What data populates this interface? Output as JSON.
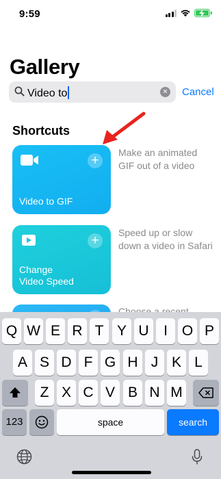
{
  "status_bar": {
    "time": "9:59"
  },
  "page": {
    "title": "Gallery"
  },
  "search": {
    "value": "Video to",
    "cancel_label": "Cancel"
  },
  "section": {
    "title": "Shortcuts"
  },
  "shortcuts": [
    {
      "label": "Video to GIF",
      "description": "Make an animated GIF out of a video",
      "icon": "video-camera-icon",
      "color": "#19bff5"
    },
    {
      "label": "Change Video Speed",
      "label_lines": [
        "Change",
        "Video Speed"
      ],
      "description": "Speed up or slow down a video in Safari",
      "icon": "play-icon",
      "color": "#1fd0dd"
    },
    {
      "label": "",
      "description": "Choose a recent",
      "icon": "",
      "color": "#2cb9f6"
    }
  ],
  "keyboard": {
    "row1": [
      "Q",
      "W",
      "E",
      "R",
      "T",
      "Y",
      "U",
      "I",
      "O",
      "P"
    ],
    "row2": [
      "A",
      "S",
      "D",
      "F",
      "G",
      "H",
      "J",
      "K",
      "L"
    ],
    "row3": [
      "Z",
      "X",
      "C",
      "V",
      "B",
      "N",
      "M"
    ],
    "numbers_label": "123",
    "space_label": "space",
    "search_label": "search"
  },
  "colors": {
    "accent": "#0a7aff",
    "battery": "#34c759",
    "annotation_arrow": "#e8241f"
  }
}
